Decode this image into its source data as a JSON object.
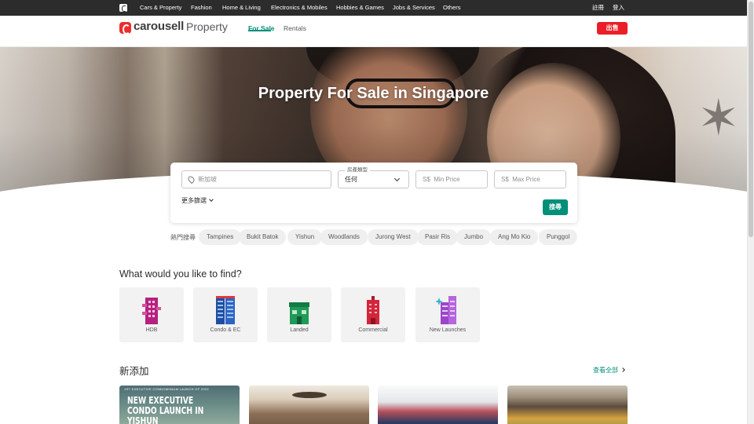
{
  "topbar": {
    "categories": [
      "Cars & Property",
      "Fashion",
      "Home & Living",
      "Electronics & Mobiles",
      "Hobbies & Games",
      "Jobs & Services",
      "Others"
    ],
    "register": "註冊",
    "login": "登入"
  },
  "header": {
    "brand": "carousell",
    "brand_sub": "Property",
    "tabs": [
      "For Sale",
      "Rentals"
    ],
    "active_tab": "For Sale",
    "sell_button": "出售"
  },
  "hero": {
    "title": "Property For Sale in Singapore"
  },
  "search": {
    "location_placeholder": "新加坡",
    "property_type_label": "房產類型",
    "property_type_value": "任何",
    "min_price_prefix": "S$",
    "min_price_placeholder": "Min Price",
    "max_price_prefix": "S$",
    "max_price_placeholder": "Max Price",
    "more_filters": "更多篩選",
    "search_button": "搜尋"
  },
  "popular": {
    "label": "熱門搜尋",
    "chips": [
      "Tampines",
      "Bukit Batok",
      "Yishun",
      "Woodlands",
      "Jurong West",
      "Pasir Ris",
      "Jumbo",
      "Ang Mo Kio",
      "Punggol"
    ]
  },
  "find": {
    "title": "What would you like to find?",
    "categories": [
      {
        "label": "HDB",
        "icon": "hdb-building-icon",
        "color": "#b5217f"
      },
      {
        "label": "Condo & EC",
        "icon": "condo-building-icon",
        "color": "#1f4ea1"
      },
      {
        "label": "Landed",
        "icon": "landed-house-icon",
        "color": "#1f9a57"
      },
      {
        "label": "Commercial",
        "icon": "commercial-building-icon",
        "color": "#d3263a"
      },
      {
        "label": "New Launches",
        "icon": "new-launch-building-icon",
        "color": "#9b45c9"
      }
    ]
  },
  "recent": {
    "title": "新添加",
    "view_all": "查看全部",
    "listings": [
      {
        "tag": "1ST EXECUTIVE CONDOMINIUM LAUNCH OF 2022",
        "headline": "NEW EXECUTIVE CONDO LAUNCH IN YISHUN"
      },
      {
        "tag": "",
        "headline": ""
      },
      {
        "tag": "",
        "headline": ""
      },
      {
        "tag": "",
        "headline": ""
      }
    ]
  },
  "colors": {
    "accent": "#008f79",
    "sell": "#ea1e26",
    "brand": "#ee2c2c",
    "topbar": "#2c2c2d"
  }
}
